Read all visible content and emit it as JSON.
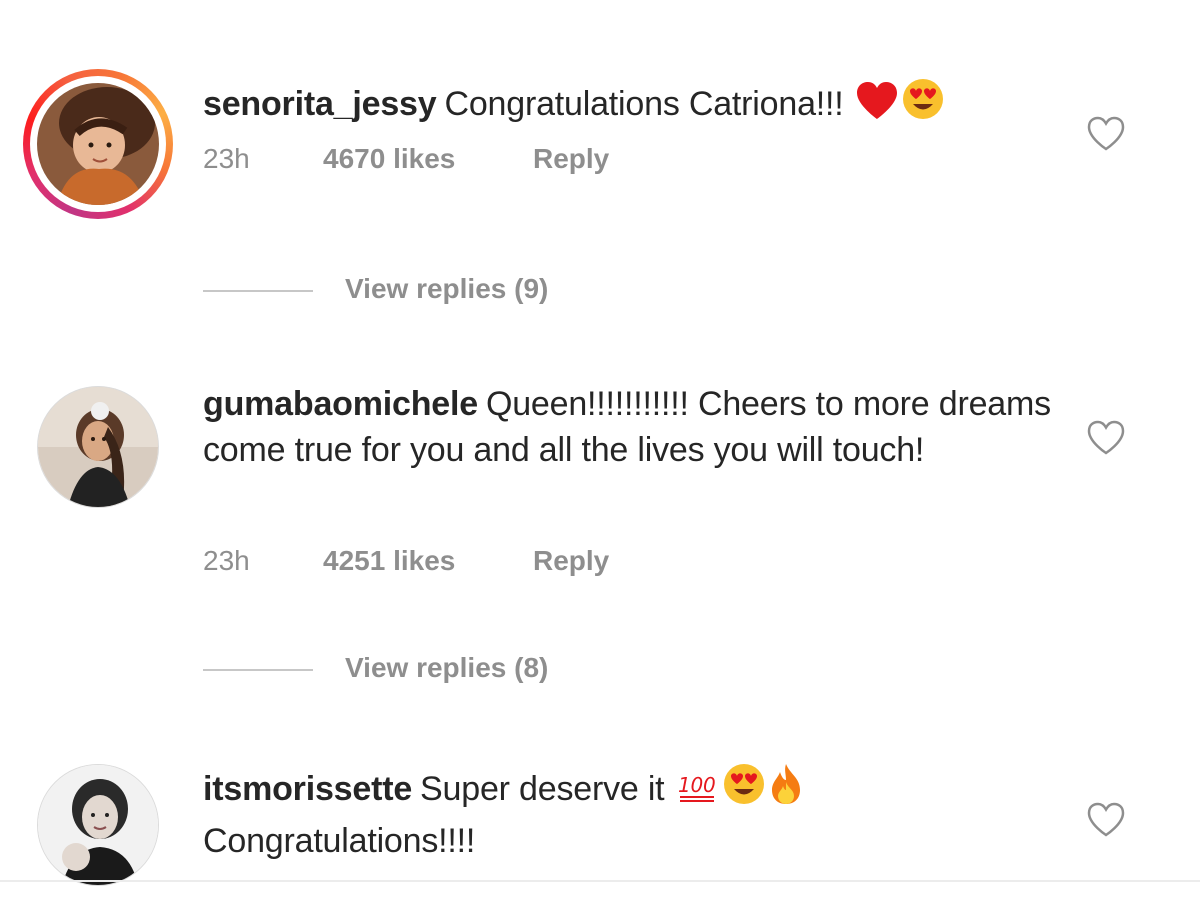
{
  "comments": [
    {
      "username": "senorita_jessy",
      "text": "Congratulations Catriona!!!",
      "emojis": [
        "heart-emoji",
        "heart-eyes-emoji"
      ],
      "time": "23h",
      "likes": "4670 likes",
      "reply_label": "Reply",
      "view_replies": "View replies (9)",
      "has_story_ring": true
    },
    {
      "username": "gumabaomichele",
      "text": "Queen!!!!!!!!!!! Cheers to more dreams come true for you and all the lives you will touch!",
      "emojis": [],
      "time": "23h",
      "likes": "4251 likes",
      "reply_label": "Reply",
      "view_replies": "View replies (8)",
      "has_story_ring": false
    },
    {
      "username": "itsmorissette",
      "text_line1": "Super deserve it",
      "text_line2": "Congratulations!!!!",
      "emojis": [
        "hundred-points-emoji",
        "heart-eyes-emoji",
        "fire-emoji"
      ],
      "has_story_ring": false
    }
  ],
  "colors": {
    "text": "#262626",
    "meta": "#8e8e8e",
    "story_ring_start": "#c13584",
    "story_ring_end": "#fcaf45"
  },
  "icons": {
    "like": "heart-outline-icon"
  }
}
